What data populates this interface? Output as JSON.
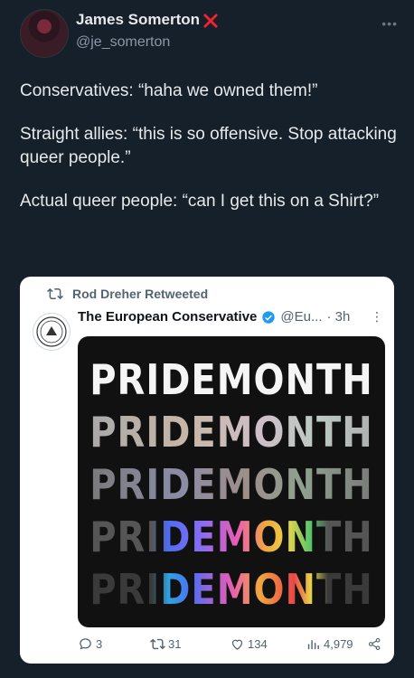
{
  "author": {
    "display_name": "James Somerton",
    "handle": "@je_somerton",
    "badge_icon": "red-x-icon"
  },
  "more_icon": "more-horizontal-icon",
  "tweet": {
    "paragraphs": [
      "Conservatives: “haha we owned them!”",
      "Straight allies: “this is so offensive. Stop attacking queer people.”",
      "Actual queer people: “can I get this on a Shirt?”"
    ]
  },
  "quoted": {
    "retweeted_by": "Rod Dreher Retweeted",
    "author_name": "The European Conservative",
    "author_handle": "@Eu...",
    "time": "· 3h",
    "image_rows": [
      "PRIDEMONTH",
      "PRIDEMONTH",
      "PRIDEMONTH",
      "PRIDEMONTH",
      "PRIDEMONTH"
    ],
    "actions": {
      "replies": "3",
      "retweets": "31",
      "likes": "134",
      "views": "4,979"
    }
  },
  "colors": {
    "background": "#15202b",
    "badge": "#f4212e",
    "verified": "#1d9bf0",
    "rainbow": [
      "#4f6df5",
      "#8a6df2",
      "#e85db5",
      "#f0a640",
      "#e8d44a",
      "#56c46c",
      "#2fa3e0",
      "#e94747"
    ]
  }
}
